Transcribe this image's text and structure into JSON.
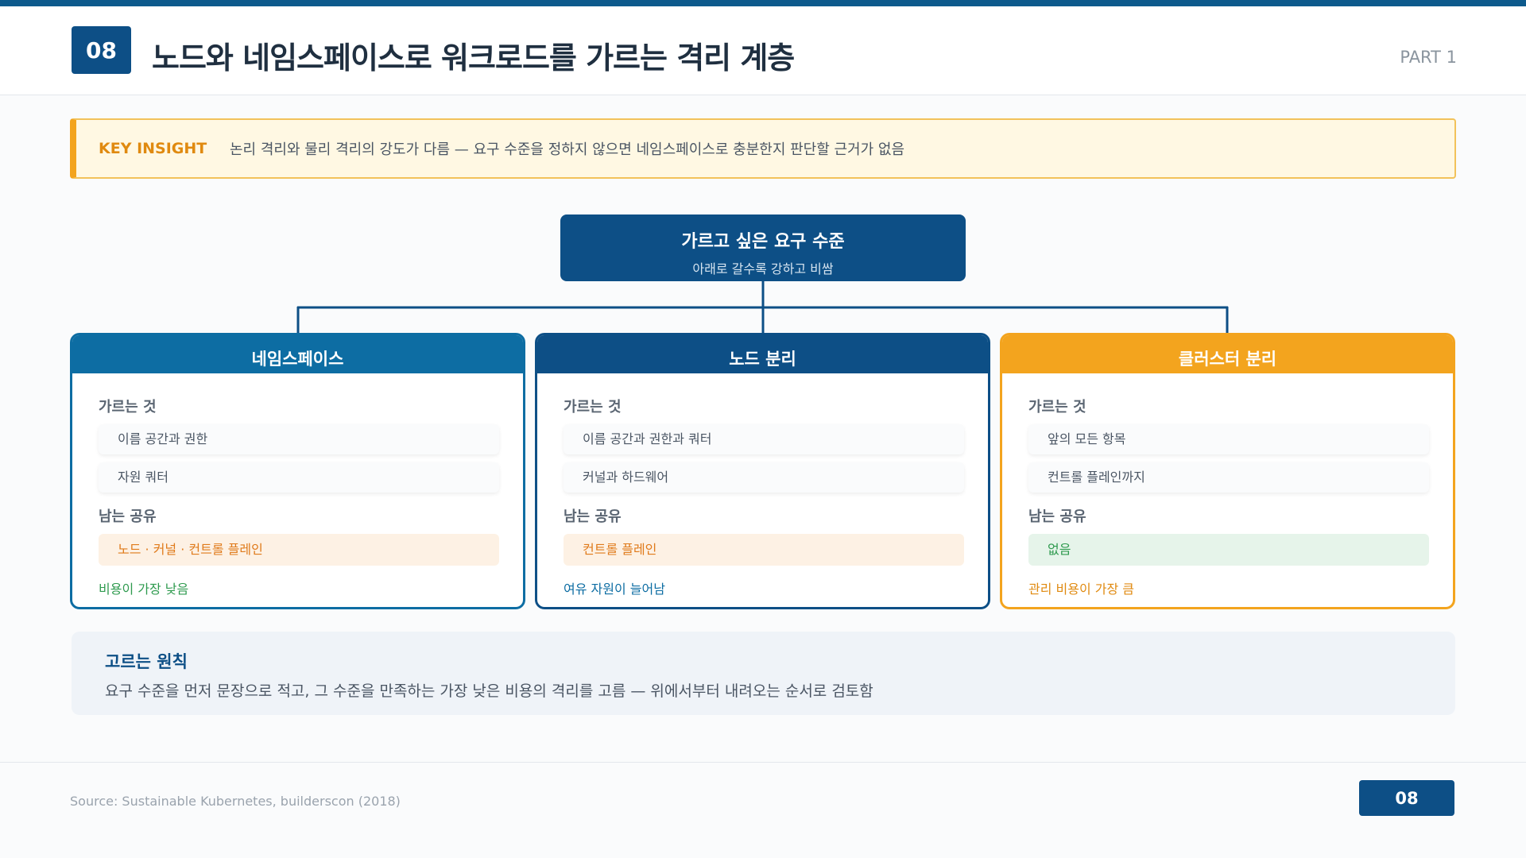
{
  "header": {
    "slide_number": "08",
    "title": "노드와 네임스페이스로 워크로드를 가르는 격리 계층",
    "part": "PART 1"
  },
  "insight": {
    "tag": "KEY INSIGHT",
    "text": "논리 격리와 물리 격리의 강도가 다름 — 요구 수준을 정하지 않으면 네임스페이스로 충분한지 판단할 근거가 없음"
  },
  "root": {
    "title": "가르고 싶은 요구 수준",
    "subtitle": "아래로 갈수록 강하고 비쌈"
  },
  "cards": [
    {
      "title": "네임스페이스",
      "separates_label": "가르는 것",
      "separates": [
        "이름 공간과 권한",
        "자원 쿼터"
      ],
      "shared_label": "남는 공유",
      "shared": "노드 · 커널 · 컨트롤 플레인",
      "note": "비용이 가장 낮음"
    },
    {
      "title": "노드 분리",
      "separates_label": "가르는 것",
      "separates": [
        "이름 공간과 권한과 쿼터",
        "커널과 하드웨어"
      ],
      "shared_label": "남는 공유",
      "shared": "컨트롤 플레인",
      "note": "여유 자원이 늘어남"
    },
    {
      "title": "클러스터 분리",
      "separates_label": "가르는 것",
      "separates": [
        "앞의 모든 항목",
        "컨트롤 플레인까지"
      ],
      "shared_label": "남는 공유",
      "shared": "없음",
      "note": "관리 비용이 가장 큼"
    }
  ],
  "principle": {
    "title": "고르는 원칙",
    "text": "요구 수준을 먼저 문장으로 적고, 그 수준을 만족하는 가장 낮은 비용의 격리를 고름 — 위에서부터 내려오는 순서로 검토함"
  },
  "footer": {
    "source": "Source: Sustainable Kubernetes, builderscon (2018)",
    "page": "08"
  },
  "colors": {
    "primary": "#0d4f86",
    "secondary": "#0d6da3",
    "accent": "#f3a41e",
    "insight_bg": "#fff8e3",
    "ok_green": "#2e9a4e"
  }
}
